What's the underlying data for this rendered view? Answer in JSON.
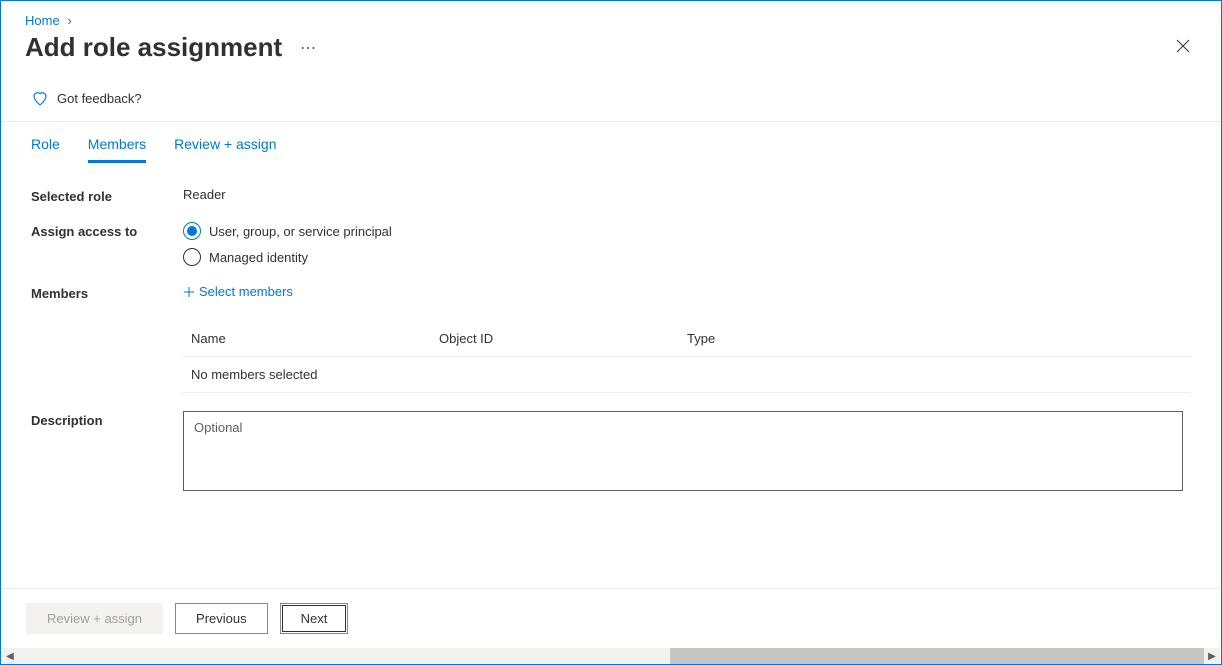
{
  "breadcrumb": {
    "home": "Home"
  },
  "title": "Add role assignment",
  "feedback_label": "Got feedback?",
  "tabs": [
    {
      "label": "Role"
    },
    {
      "label": "Members"
    },
    {
      "label": "Review + assign"
    }
  ],
  "form": {
    "selected_role_label": "Selected role",
    "selected_role_value": "Reader",
    "assign_access_label": "Assign access to",
    "radio_user": "User, group, or service principal",
    "radio_managed": "Managed identity",
    "members_label": "Members",
    "select_members": "Select members",
    "table": {
      "col_name": "Name",
      "col_oid": "Object ID",
      "col_type": "Type",
      "empty": "No members selected"
    },
    "description_label": "Description",
    "description_placeholder": "Optional"
  },
  "footer": {
    "review": "Review + assign",
    "previous": "Previous",
    "next": "Next"
  }
}
